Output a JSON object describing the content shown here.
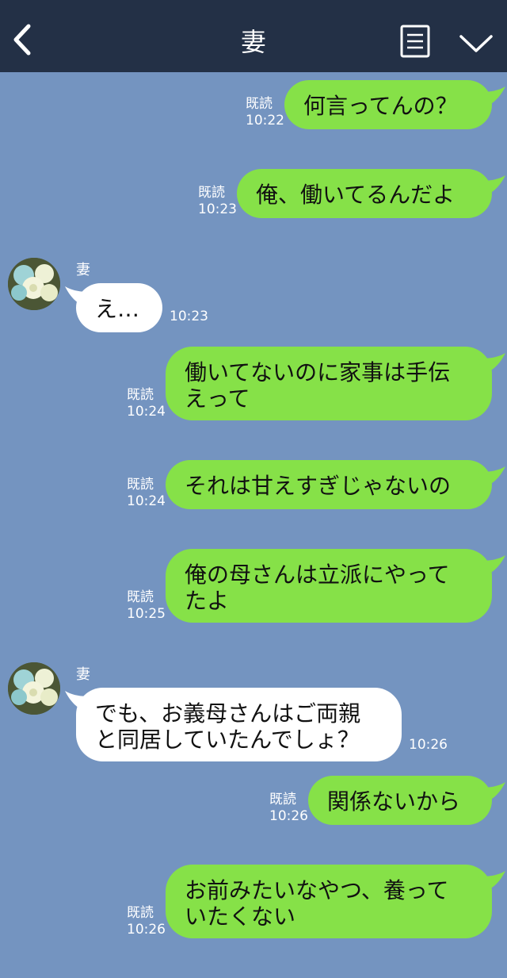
{
  "header": {
    "title": "妻",
    "back_icon": "chevron-left-icon",
    "menu_icon": "list-icon",
    "expand_icon": "chevron-down-icon"
  },
  "messages": [
    {
      "type": "sent",
      "text": [
        "何言ってんの？"
      ],
      "read": "既読",
      "time": "10:22"
    },
    {
      "type": "sent",
      "text": [
        "俺、働いてるんだよ"
      ],
      "read": "既読",
      "time": "10:23"
    },
    {
      "type": "received",
      "sender": "妻",
      "text": [
        "え…"
      ],
      "time": "10:23"
    },
    {
      "type": "sent",
      "text": [
        "働いてないのに家事は手伝",
        "えって"
      ],
      "read": "既読",
      "time": "10:24"
    },
    {
      "type": "sent",
      "text": [
        "それは甘えすぎじゃないの"
      ],
      "read": "既読",
      "time": "10:24"
    },
    {
      "type": "sent",
      "text": [
        "俺の母さんは立派にやって",
        "たよ"
      ],
      "read": "既読",
      "time": "10:25"
    },
    {
      "type": "received",
      "sender": "妻",
      "text": [
        "でも、お義母さんはご両親",
        "と同居していたんでしょ？"
      ],
      "time": "10:26"
    },
    {
      "type": "sent",
      "text": [
        "関係ないから"
      ],
      "read": "既読",
      "time": "10:26"
    },
    {
      "type": "sent",
      "text": [
        "お前みたいなやつ、養って",
        "いたくない"
      ],
      "read": "既読",
      "time": "10:26"
    }
  ],
  "colors": {
    "background": "#7494c0",
    "header": "#233046",
    "sent_bubble": "#86e148",
    "received_bubble": "#ffffff"
  }
}
